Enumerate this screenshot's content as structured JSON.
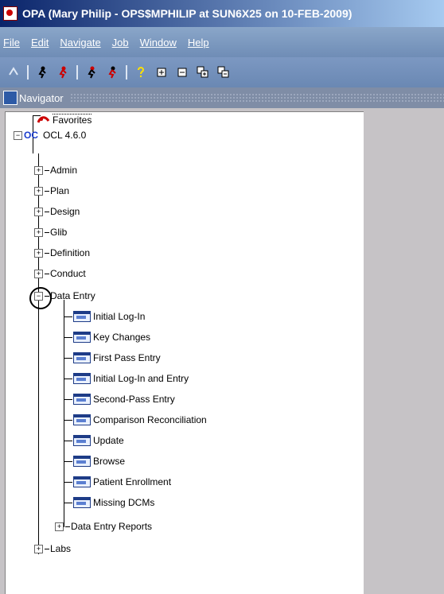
{
  "window": {
    "title": "OPA (Mary Philip - OPS$MPHILIP at SUN6X25 on 10-FEB-2009)"
  },
  "menu": [
    "File",
    "Edit",
    "Navigate",
    "Job",
    "Window",
    "Help"
  ],
  "toolbar": {
    "icons": [
      "undo-icon",
      "runner-icon",
      "runner-icon",
      "runner-icon",
      "runner-icon",
      "help-icon",
      "expand-icon",
      "collapse-icon",
      "expand-all-icon",
      "collapse-all-icon"
    ]
  },
  "navigator": {
    "title": "Navigator"
  },
  "tree": {
    "favorites": "Favorites",
    "root_prefix": "OC",
    "root": "OCL 4.6.0",
    "nodes": [
      "Admin",
      "Plan",
      "Design",
      "Glib",
      "Definition",
      "Conduct"
    ],
    "data_entry": "Data Entry",
    "forms": [
      "Initial Log-In",
      "Key Changes",
      "First Pass Entry",
      "Initial Log-In and Entry",
      "Second-Pass Entry",
      "Comparison Reconciliation",
      "Update",
      "Browse",
      "Patient Enrollment",
      "Missing DCMs"
    ],
    "reports": "Data Entry Reports",
    "labs": "Labs"
  }
}
